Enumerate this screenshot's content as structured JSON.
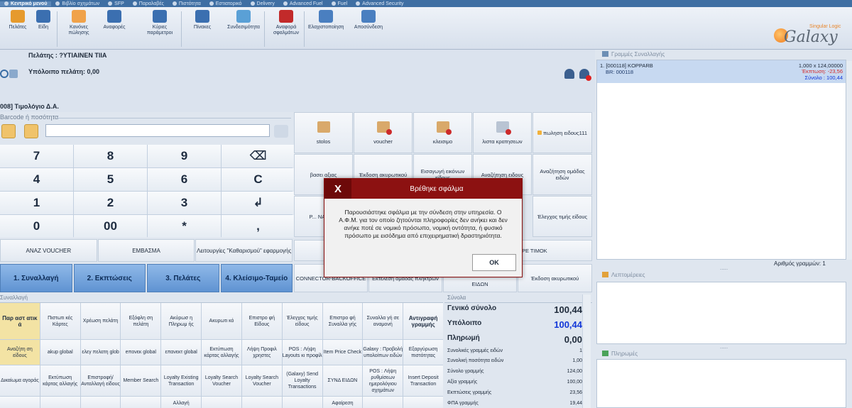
{
  "top_menu": [
    "Κεντρικό μενού",
    "Βιβλίο σχημάτων",
    "SFP",
    "Παραλαβές",
    "Πιστότητα",
    "Εστιατορικό",
    "Delivery",
    "Advanced Fuel",
    "Fuel",
    "Advanced Security"
  ],
  "ribbon": {
    "items": [
      {
        "label": "Πελάτες",
        "color": "#e69a2d"
      },
      {
        "label": "Είδη",
        "color": "#3b6fb0"
      },
      {
        "label": "Κανόνες πώλησης",
        "color": "#f0a24a"
      },
      {
        "label": "Αναφορές",
        "color": "#3b6fb0"
      },
      {
        "label": "Κύριες παράμετροι",
        "color": "#3b6fb0"
      },
      {
        "label": "Πίνακες",
        "color": "#3b6fb0"
      },
      {
        "label": "Συνδεσιμότητα",
        "color": "#5aa0d6"
      },
      {
        "label": "Αναφορά σφαλμάτων",
        "color": "#c22a2a"
      },
      {
        "label": "Ελαχιστοποίηση",
        "color": "#4a7fc0"
      },
      {
        "label": "Αποσύνδεση",
        "color": "#4a7fc0"
      }
    ],
    "logo_text": "Galaxy",
    "logo_sub": "Singular Logic"
  },
  "customer": {
    "name_line": "Πελάτης : ?ΥΤΙΑΙΝΕΝ ΤΙΙΑ",
    "balance_line": "Υπόλοιπο πελάτη: 0,00"
  },
  "document_title": "008] Τιμολόγιο Δ.Α.",
  "barcode_label": "Barcode ή ποσότητα",
  "keypad": [
    "7",
    "8",
    "9",
    "⌫",
    "4",
    "5",
    "6",
    "C",
    "1",
    "2",
    "3",
    "↲",
    "0",
    "00",
    "*",
    ","
  ],
  "action_row": [
    "ΑΝΑΖ VOUCHER",
    "ΕΜΒΑΣΜΑ",
    "Λειτουργίες \"Καθαρισμού\" εφαρμογής"
  ],
  "tabs": [
    "1. Συναλλαγή",
    "2. Εκπτώσεις",
    "3. Πελάτες",
    "4. Κλείσιμο-Ταμείο"
  ],
  "quick_grid": {
    "row1": [
      "stolos",
      "voucher",
      "κλεισιμο",
      "λιστα κρατησεων",
      "πωληση ειδους111"
    ],
    "row2": [
      "βασει αξιας",
      "Έκδοση ακυρωτικού",
      "Εισαγωγή εικόνων είδους",
      "Αναζήτηση ειδους",
      "Αναζήτηση ομάδας ειδών"
    ],
    "row3": [
      "Ρ... ΝΑΡΟ...",
      "Έλεγχος τιμής είδους"
    ],
    "row4": [
      "ΑΦΑΙΡΕ ΤΙΜΟΚ"
    ],
    "row5": [
      "CONNECTOR-BACKOFFICE",
      "Εκτέλεση ομάδας πλήκτρων",
      "ΕΙΔΩΝ",
      "Έκδοση ακυρωτικού"
    ]
  },
  "transaction_section_label": "Συναλλαγή",
  "bottom_grid": [
    "Παρ αστ ατικ ά",
    "Πιστωτι κές Κάρτες",
    "Χρέωση πελάτη",
    "Εξόφλη ση πελάτη",
    "Ακύρωσ η Πληρωμ ής",
    "Ακυρωτι κό",
    "Επιστρο φή Είδους",
    "Έλεγχος τιμής είδους",
    "Επιστρο φή Συναλλα γής",
    "Συναλλα γή σε αναμονή",
    "Αντιγραφή γραμμής",
    "Αναζήτη ση είδους",
    "akup global",
    "ελεγ πελατη glob",
    "eπονεκ global",
    "επανεκτ global",
    "Εκτύπωση κάρτας αλλαγής",
    "Λήψη Προφιλ χρηστες",
    "POS : Λήψη Layouts κι προφίλ",
    "Item Price Check",
    "Galaxy : Προβολή υπολοίπων ειδών",
    "Εξαργύρωση πιστότητας",
    "Δικαίωμα αγοράς",
    "Εκτύπωση κάρτας αλλαγής",
    "Επιστροφή/Ανταλλαγή είδους",
    "Member Search",
    "Loyalty Existing Transaction",
    "Loyalty Search Voucher",
    "Loyalty Search Voucher",
    "(Galaxy) Send Loyalty Transactions",
    "ΣΥΝΔ ΕΙΔΩΝ",
    "POS : Λήψη ρυθμίσεων ημερολόγιου σχημάτων",
    "Insert Deposit Transaction",
    "",
    "",
    "",
    "",
    "Αλλαγή",
    "",
    "",
    "",
    "Αφαίρεση",
    "",
    ""
  ],
  "totals": {
    "header": "Σύνολα",
    "rows": [
      {
        "label": "Γενικό σύνολο",
        "value": "100,44",
        "size": "big"
      },
      {
        "label": "Υπόλοιπο",
        "value": "100,44",
        "size": "big",
        "blue": true
      },
      {
        "label": "Πληρωμή",
        "value": "0,00",
        "size": "big"
      },
      {
        "label": "Συνολικές γραμμές ειδών",
        "value": "1",
        "size": "sm"
      },
      {
        "label": "Συνολική ποσότητα ειδών",
        "value": "1,00",
        "size": "sm"
      },
      {
        "label": "Σύνολο γραμμής",
        "value": "124,00",
        "size": "sm"
      },
      {
        "label": "Αξία γραμμής",
        "value": "100,00",
        "size": "sm"
      },
      {
        "label": "Εκπτώσεις γραμμής",
        "value": "23,56",
        "size": "sm"
      },
      {
        "label": "ΦΠΑ γραμμής",
        "value": "19,44",
        "size": "sm"
      }
    ]
  },
  "right_panel": {
    "lines_header": "Γραμμές Συναλλαγής",
    "line": {
      "desc": "1. [000118] KOPPARB",
      "br": "BR: 000118",
      "qty_price": "1,000 x 124,00000",
      "discount": "Έκπτωση: -23,56",
      "total": "Σύνολο : 100,44"
    },
    "row_count": "Αριθμός γραμμών: 1",
    "details_header": "Λεπτομέρειες",
    "payments_header": "Πληρωμές",
    "more": "....."
  },
  "modal": {
    "close_label": "X",
    "title": "Βρέθηκε σφάλμα",
    "message": "Παρουσιάστηκε σφάλμα με την σύνδεση στην υπηρεσία. Ο Α.Φ.Μ. για τον οποίο ζητούνται πληροφορίες δεν ανήκει και δεν ανήκε ποτέ σε νομικό πρόσωπο, νομική οντότητα, ή φυσικό πρόσωπο με εισόδημα από επιχειρηματική δραστηριότητα.",
    "ok_label": "OK"
  }
}
